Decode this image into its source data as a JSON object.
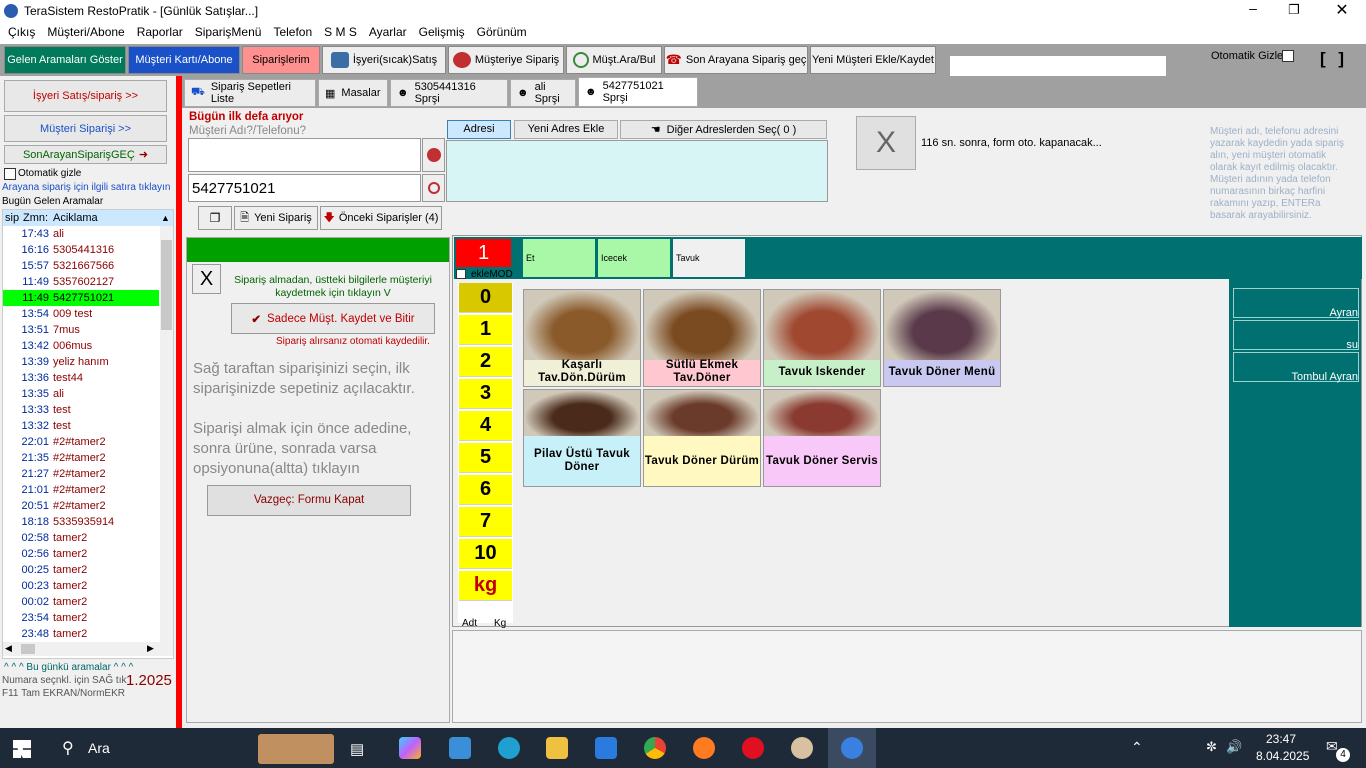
{
  "window": {
    "title": "TeraSistem RestoPratik - [Günlük Satışlar...]"
  },
  "menu": [
    "Çıkış",
    "Müşteri/Abone",
    "Raporlar",
    "SiparişMenü",
    "Telefon",
    "S M S",
    "Ayarlar",
    "Gelişmiş",
    "Görünüm"
  ],
  "toolbar": {
    "gelen": "Gelen Aramaları Göster",
    "musteri_karti": "Müşteri Kartı/Abone",
    "siparislerim": "Siparişlerim",
    "isyeri": "İşyeri(sıcak)Satış",
    "musteriye": "Müşteriye Sipariş",
    "must_ara": "Müşt.Ara/Bul",
    "son_arayan": "Son Arayana Sipariş geç",
    "yeni_musteri": "Yeni Müşteri Ekle/Kaydet",
    "otomatik_gizle": "Otomatik Gizle",
    "brackets": "[ ]"
  },
  "left": {
    "isyeri_btn": "İşyeri Satış/sipariş >>",
    "musteri_btn": "Müşteri Siparişi >>",
    "son_arayan_btn": "SonArayanSiparişGEÇ",
    "otomatik": "Otomatik gizle",
    "hint": "Arayana sipariş için ilgili satıra tıklayın",
    "bugun": "Bugün Gelen Aramalar",
    "col_sip": "sip",
    "col_zmn": "Zmn:",
    "col_acik": "Aciklama",
    "footer1": "^ ^ ^ Bu günkü aramalar ^ ^ ^",
    "footer2": "Numara seçnkl. için SAĞ tık",
    "footer3": "F11 Tam EKRAN/NormEKR",
    "year": "1.2025"
  },
  "calls": [
    {
      "t": "17:43",
      "d": "ali"
    },
    {
      "t": "16:16",
      "d": "5305441316"
    },
    {
      "t": "15:57",
      "d": "5321667566"
    },
    {
      "t": "11:49",
      "d": "5357602127"
    },
    {
      "t": "11:49",
      "d": "5427751021",
      "sel": true
    },
    {
      "t": "13:54",
      "d": "009 test"
    },
    {
      "t": "13:51",
      "d": "7mus"
    },
    {
      "t": "13:42",
      "d": "006mus"
    },
    {
      "t": "13:39",
      "d": "yeliz hanım"
    },
    {
      "t": "13:36",
      "d": "test44"
    },
    {
      "t": "13:35",
      "d": "ali"
    },
    {
      "t": "13:33",
      "d": "test"
    },
    {
      "t": "13:32",
      "d": "test"
    },
    {
      "t": "22:01",
      "d": "#2#tamer2"
    },
    {
      "t": "21:35",
      "d": "#2#tamer2"
    },
    {
      "t": "21:27",
      "d": "#2#tamer2"
    },
    {
      "t": "21:01",
      "d": "#2#tamer2"
    },
    {
      "t": "20:51",
      "d": "#2#tamer2"
    },
    {
      "t": "18:18",
      "d": "5335935914"
    },
    {
      "t": "02:58",
      "d": "tamer2"
    },
    {
      "t": "02:56",
      "d": "tamer2"
    },
    {
      "t": "00:25",
      "d": "tamer2"
    },
    {
      "t": "00:23",
      "d": "tamer2"
    },
    {
      "t": "00:02",
      "d": "tamer2"
    },
    {
      "t": "23:54",
      "d": "tamer2"
    },
    {
      "t": "23:48",
      "d": "tamer2"
    }
  ],
  "tabs": [
    "Sipariş Sepetleri Liste",
    "Masalar",
    "5305441316 Sprşi",
    "ali Sprşi",
    "5427751021 Sprşi"
  ],
  "order": {
    "bugun": "Bügün ilk defa arıyor",
    "musteri_label": "Müşteri Adı?/Telefonu?",
    "phone": "5427751021",
    "adresi": "Adresi",
    "yeni_adres": "Yeni Adres Ekle",
    "diger": "Diğer Adreslerden Seç( 0 )",
    "close_x": "X",
    "countdown": "116 sn. sonra, form oto. kapanacak...",
    "info": "Müşteri adı, telefonu adresini yazarak kaydedin yada sipariş alın, yeni müşteri otomatik olarak kayıt edilmiş olacaktır. Müşteri adının yada telefon numarasının birkaç harfini rakamını yazıp, ENTERa basarak arayabilirsiniz.",
    "yeni_siparis": "Yeni Sipariş",
    "onceki": "Önceki Siparişler (4)",
    "x2": "X",
    "almadan": "Sipariş almadan, üstteki bilgilerle müşteriyi kaydetmek için tıklayın V",
    "sadece": "Sadece Müşt. Kaydet ve Bitir",
    "alirsaniz": "Sipariş alırsanız otomati kaydedilir.",
    "hint1": "Sağ taraftan siparişinizi seçin, ilk siparişinizde sepetiniz açılacaktır.",
    "hint2": "Siparişi almak için önce adedine, sonra ürüne, sonrada varsa opsiyonuna(altta) tıklayın",
    "vazgec": "Vazgeç: Formu Kapat"
  },
  "qty": {
    "current": "1",
    "eklemod": "ekleMOD",
    "buttons": [
      "0",
      "1",
      "2",
      "3",
      "4",
      "5",
      "6",
      "7",
      "10",
      "kg"
    ],
    "adt": "Adt",
    "kg": "Kg"
  },
  "categories": [
    "Et",
    "Icecek",
    "Tavuk"
  ],
  "products": [
    {
      "name": "Kaşarlı Tav.Dön.Dürüm",
      "bg": "#f0f0d8"
    },
    {
      "name": "Sütlü Ekmek Tav.Döner",
      "bg": "#ffc8d0"
    },
    {
      "name": "Tavuk Iskender",
      "bg": "#c8f0c8"
    },
    {
      "name": "Tavuk Döner Menü",
      "bg": "#c8c8f0"
    },
    {
      "name": "Pilav Üstü Tavuk Döner",
      "bg": "#c8f0f8"
    },
    {
      "name": "Tavuk Döner Dürüm",
      "bg": "#fff8c0"
    },
    {
      "name": "Tavuk Döner Servis",
      "bg": "#f8c8f8"
    }
  ],
  "options": [
    "Ayran",
    "su",
    "Tombul Ayran"
  ],
  "taskbar": {
    "search": "Ara",
    "time": "23:47",
    "date": "8.04.2025",
    "badge": "4"
  }
}
